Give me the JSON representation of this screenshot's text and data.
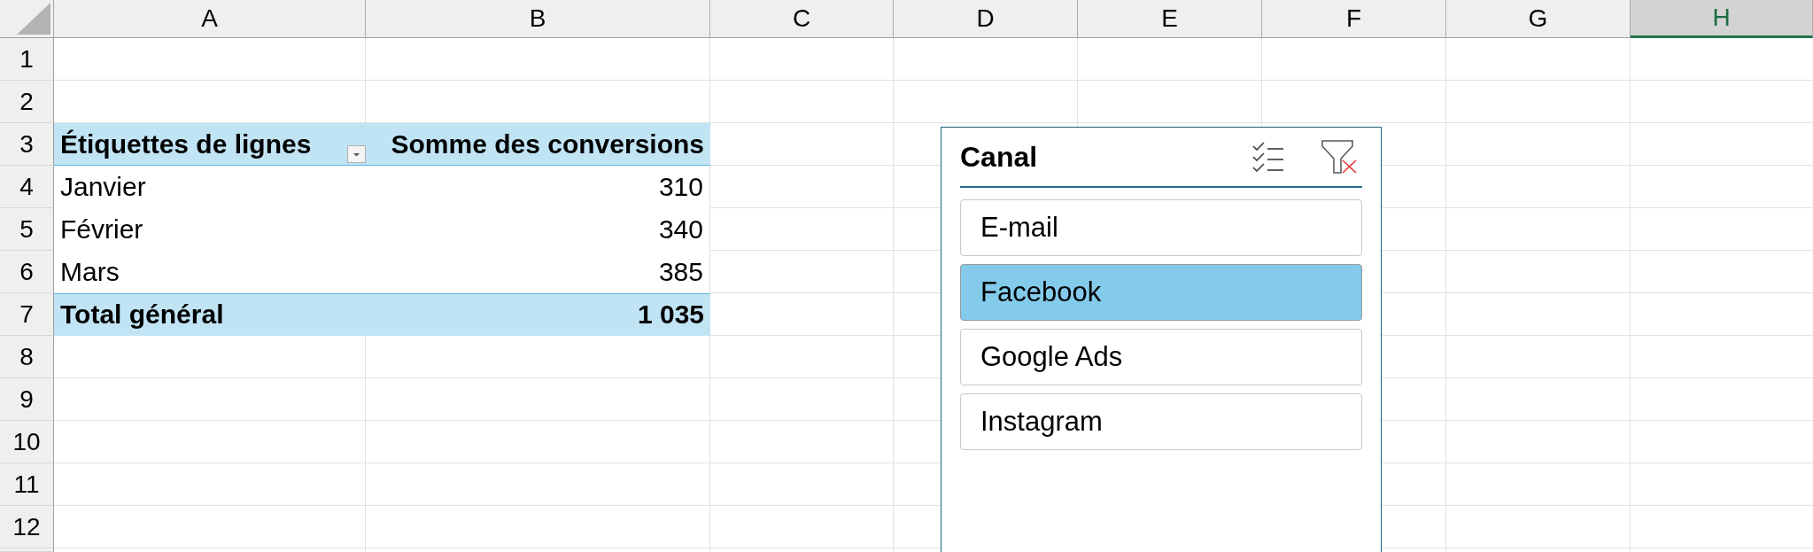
{
  "sheet": {
    "columns": [
      {
        "label": "A",
        "selected": false
      },
      {
        "label": "B",
        "selected": false
      },
      {
        "label": "C",
        "selected": false
      },
      {
        "label": "D",
        "selected": false
      },
      {
        "label": "E",
        "selected": false
      },
      {
        "label": "F",
        "selected": false
      },
      {
        "label": "G",
        "selected": false
      },
      {
        "label": "H",
        "selected": true
      }
    ],
    "rows": [
      "1",
      "2",
      "3",
      "4",
      "5",
      "6",
      "7",
      "8",
      "9",
      "10",
      "11",
      "12"
    ]
  },
  "pivot_table": {
    "columns": [
      "Étiquettes de lignes",
      "Somme des conversions"
    ],
    "rows": [
      {
        "label": "Janvier",
        "value": "310"
      },
      {
        "label": "Février",
        "value": "340"
      },
      {
        "label": "Mars",
        "value": "385"
      }
    ],
    "total": {
      "label": "Total général",
      "value": "1 035"
    }
  },
  "slicer": {
    "title": "Canal",
    "items": [
      {
        "label": "E-mail",
        "selected": false
      },
      {
        "label": "Facebook",
        "selected": true
      },
      {
        "label": "Google Ads",
        "selected": false
      },
      {
        "label": "Instagram",
        "selected": false
      }
    ]
  }
}
